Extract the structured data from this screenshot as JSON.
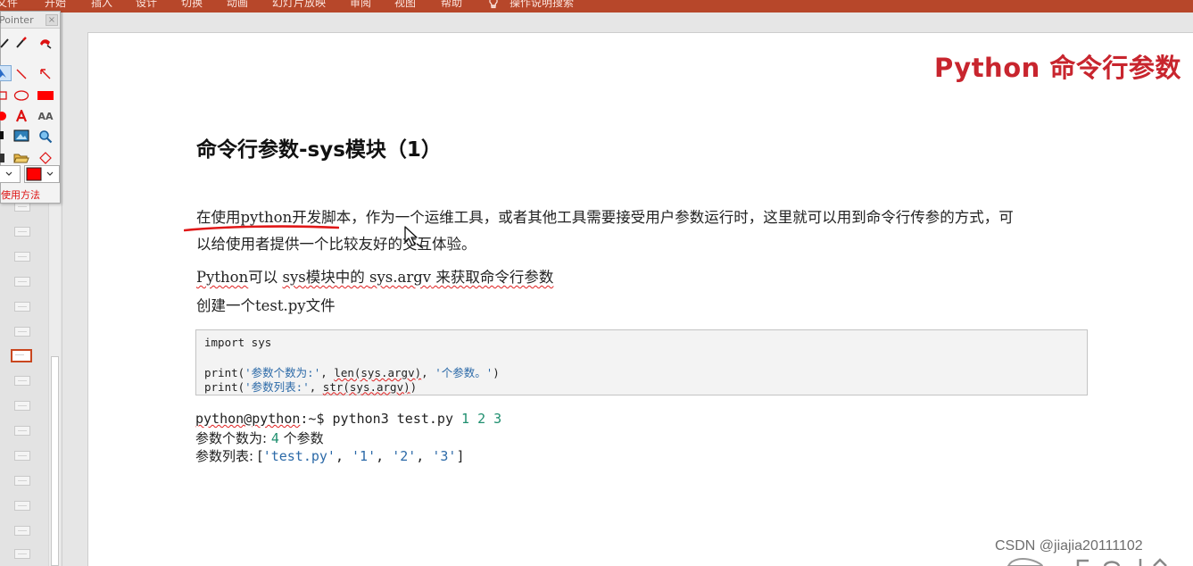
{
  "ribbon": {
    "tabs": [
      "文件",
      "开始",
      "插入",
      "设计",
      "切换",
      "动画",
      "幻灯片放映",
      "审阅",
      "视图",
      "帮助"
    ],
    "search_placeholder": "操作说明搜索"
  },
  "toolbox": {
    "title": "Pointer",
    "close_label": "×",
    "help_text": "使用方法",
    "text_tool_label": "AA",
    "colors": {
      "pen": "#ff0000",
      "accent": "#d11111"
    }
  },
  "slide": {
    "title": "Python 命令行参数",
    "heading": "命令行参数-sys模块（1）",
    "para1_line1": "在使用python开发脚本，作为一个运维工具，或者其他工具需要接受用户参数运行时，这里就可以用到命令行传参的方式，可",
    "para1_line2": "以给使用者提供一个比较友好的交互体验。",
    "para2": {
      "p1": "Python",
      "p2": "可以 ",
      "p3": "sys",
      "p4": "模块中的 ",
      "p5": "sys.argv",
      "p6": " 来获取命令行参数"
    },
    "para3": "创建一个test.py文件",
    "code": {
      "line1": "import sys",
      "line3": {
        "a": "print(",
        "b": "'参数个数为:'",
        "c": ", ",
        "d": "len(sys.argv)",
        "e": ", ",
        "f": "'个参数。'",
        "g": ")"
      },
      "line4": {
        "a": "print(",
        "b": "'参数列表:'",
        "c": ", ",
        "d": "str(sys.argv)",
        "e": ")"
      }
    },
    "terminal": {
      "prompt": "python@python",
      "path": ":~$ python3 test.py ",
      "args": "1 2 3",
      "out1_label": "参数个数为: ",
      "out1_num": "4",
      "out1_suffix": " 个参数",
      "out2_label": "参数列表: [",
      "out2_s1": "'test.py'",
      "out2_sep1": ", ",
      "out2_s2": "'1'",
      "out2_sep2": ", ",
      "out2_s3": "'2'",
      "out2_sep3": ", ",
      "out2_s4": "'3'",
      "out2_end": "]"
    },
    "colors": {
      "title": "#c8252e",
      "string": "#2c6aa8",
      "number": "#1f8f6f"
    }
  },
  "watermark": "CSDN @jiajia20111102"
}
